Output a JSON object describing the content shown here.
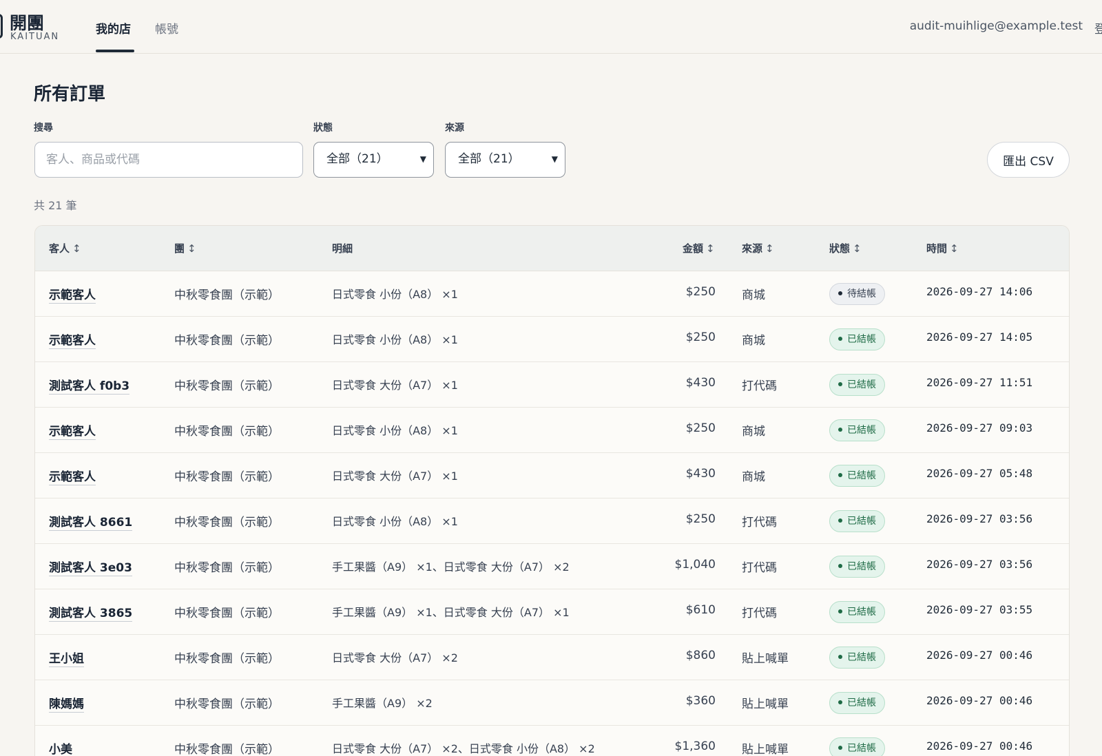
{
  "header": {
    "logo_title": "開團",
    "logo_sub": "KAITUAN",
    "tabs": [
      {
        "label": "我的店"
      },
      {
        "label": "帳號"
      }
    ],
    "user_email": "audit-muihlige@example.test",
    "edge_text": "登"
  },
  "page": {
    "title": "所有訂單",
    "search_label": "搜尋",
    "search_placeholder": "客人、商品或代碼",
    "status_label": "狀態",
    "status_value": "全部（21）",
    "source_label": "來源",
    "source_value": "全部（21）",
    "export_label": "匯出 CSV",
    "count_text": "共 21 筆"
  },
  "table": {
    "headers": {
      "customer": "客人",
      "group": "團",
      "detail": "明細",
      "amount": "金額",
      "source": "來源",
      "status": "狀態",
      "time": "時間"
    },
    "sort_glyph": "↕",
    "rows": [
      {
        "customer": "示範客人",
        "group": "中秋零食團（示範）",
        "detail": "日式零食 小份（A8） ×1",
        "amount": "$250",
        "source": "商城",
        "status": "待結帳",
        "status_type": "pending",
        "time": "2026-09-27 14:06"
      },
      {
        "customer": "示範客人",
        "group": "中秋零食團（示範）",
        "detail": "日式零食 小份（A8） ×1",
        "amount": "$250",
        "source": "商城",
        "status": "已結帳",
        "status_type": "settled",
        "time": "2026-09-27 14:05"
      },
      {
        "customer": "測試客人 f0b3",
        "group": "中秋零食團（示範）",
        "detail": "日式零食 大份（A7） ×1",
        "amount": "$430",
        "source": "打代碼",
        "status": "已結帳",
        "status_type": "settled",
        "time": "2026-09-27 11:51"
      },
      {
        "customer": "示範客人",
        "group": "中秋零食團（示範）",
        "detail": "日式零食 小份（A8） ×1",
        "amount": "$250",
        "source": "商城",
        "status": "已結帳",
        "status_type": "settled",
        "time": "2026-09-27 09:03"
      },
      {
        "customer": "示範客人",
        "group": "中秋零食團（示範）",
        "detail": "日式零食 大份（A7） ×1",
        "amount": "$430",
        "source": "商城",
        "status": "已結帳",
        "status_type": "settled",
        "time": "2026-09-27 05:48"
      },
      {
        "customer": "測試客人 8661",
        "group": "中秋零食團（示範）",
        "detail": "日式零食 小份（A8） ×1",
        "amount": "$250",
        "source": "打代碼",
        "status": "已結帳",
        "status_type": "settled",
        "time": "2026-09-27 03:56"
      },
      {
        "customer": "測試客人 3e03",
        "group": "中秋零食團（示範）",
        "detail": "手工果醬（A9） ×1、日式零食 大份（A7） ×2",
        "amount": "$1,040",
        "source": "打代碼",
        "status": "已結帳",
        "status_type": "settled",
        "time": "2026-09-27 03:56"
      },
      {
        "customer": "測試客人 3865",
        "group": "中秋零食團（示範）",
        "detail": "手工果醬（A9） ×1、日式零食 大份（A7） ×1",
        "amount": "$610",
        "source": "打代碼",
        "status": "已結帳",
        "status_type": "settled",
        "time": "2026-09-27 03:55"
      },
      {
        "customer": "王小姐",
        "group": "中秋零食團（示範）",
        "detail": "日式零食 大份（A7） ×2",
        "amount": "$860",
        "source": "貼上喊單",
        "status": "已結帳",
        "status_type": "settled",
        "time": "2026-09-27 00:46"
      },
      {
        "customer": "陳媽媽",
        "group": "中秋零食團（示範）",
        "detail": "手工果醬（A9） ×2",
        "amount": "$360",
        "source": "貼上喊單",
        "status": "已結帳",
        "status_type": "settled",
        "time": "2026-09-27 00:46"
      },
      {
        "customer": "小美",
        "group": "中秋零食團（示範）",
        "detail": "日式零食 大份（A7） ×2、日式零食 小份（A8） ×2",
        "amount": "$1,360",
        "source": "貼上喊單",
        "status": "已結帳",
        "status_type": "settled",
        "time": "2026-09-27 00:46"
      }
    ]
  }
}
